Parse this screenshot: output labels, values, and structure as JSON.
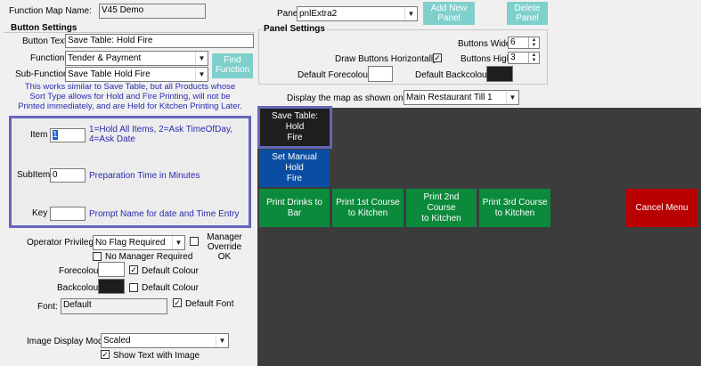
{
  "header": {
    "function_map_label": "Function Map Name:",
    "function_map_value": "V45 Demo"
  },
  "button_settings": {
    "title": "Button Settings",
    "button_text_label": "Button Text",
    "button_text_value": "Save Table: Hold Fire",
    "function_label": "Function",
    "function_value": "Tender & Payment",
    "subfunction_label": "Sub-Function",
    "subfunction_value": "Save Table Hold Fire",
    "find_function_label": "Find Function",
    "description": "This works similar to Save Table, but all Products whose Sort Type allows for Hold and Fire Printing, will not be Printed immediately, and are Held for Kitchen Printing Later.",
    "item_label": "Item",
    "item_value": "1",
    "item_help": "1=Hold All Items, 2=Ask TimeOfDay, 4=Ask Date",
    "subitem_label": "SubItem",
    "subitem_value": "0",
    "subitem_help": "Preparation Time in Minutes",
    "key_label": "Key",
    "key_value": "",
    "key_help": "Prompt Name for date and Time Entry",
    "operator_privilege_label": "Operator Privilege:",
    "operator_privilege_value": "No Flag Required",
    "manager_override_label": "Manager Override OK",
    "no_manager_required_label": "No Manager Required",
    "forecolour_label": "Forecolour",
    "default_colour_fore_label": "Default Colour",
    "backcolour_label": "Backcolour",
    "default_colour_back_label": "Default Colour",
    "font_label": "Font:",
    "font_value": "Default",
    "default_font_label": "Default Font",
    "image_display_mode_label": "Image Display Mode:",
    "image_display_mode_value": "Scaled",
    "show_text_with_image_label": "Show Text with Image"
  },
  "panel": {
    "panel_label": "Panel",
    "panel_value": "pnlExtra2",
    "add_new_panel_label": "Add New Panel",
    "delete_panel_label": "Delete Panel"
  },
  "panel_settings": {
    "title": "Panel Settings",
    "buttons_wide_label": "Buttons Wide:",
    "buttons_wide_value": "6",
    "buttons_high_label": "Buttons High:",
    "buttons_high_value": "3",
    "draw_horizontally_label": "Draw Buttons Horizontally:",
    "default_forecolour_label": "Default Forecolour",
    "default_backcolour_label": "Default Backcolour"
  },
  "till": {
    "display_label": "Display the map as shown on till:",
    "till_value": "Main Restaurant Till 1"
  },
  "pos_buttons": {
    "save_table": "Save Table:\nHold\nFire",
    "set_manual": "Set Manual\nHold\nFire",
    "print_drinks": "Print Drinks to\nBar",
    "print_1st": "Print 1st Course\nto Kitchen",
    "print_2nd": "Print 2nd\nCourse\nto Kitchen",
    "print_3rd": "Print 3rd Course\nto Kitchen",
    "cancel_menu": "Cancel Menu"
  },
  "colors": {
    "teal_button": "#7fd0cc",
    "pos_background": "#3c3c3c",
    "save_table_bg": "#1e1e1e",
    "set_manual_bg": "#0a4ea3",
    "print_green": "#0c8a3c",
    "cancel_red": "#b80000",
    "highlight": "#6666bb"
  }
}
